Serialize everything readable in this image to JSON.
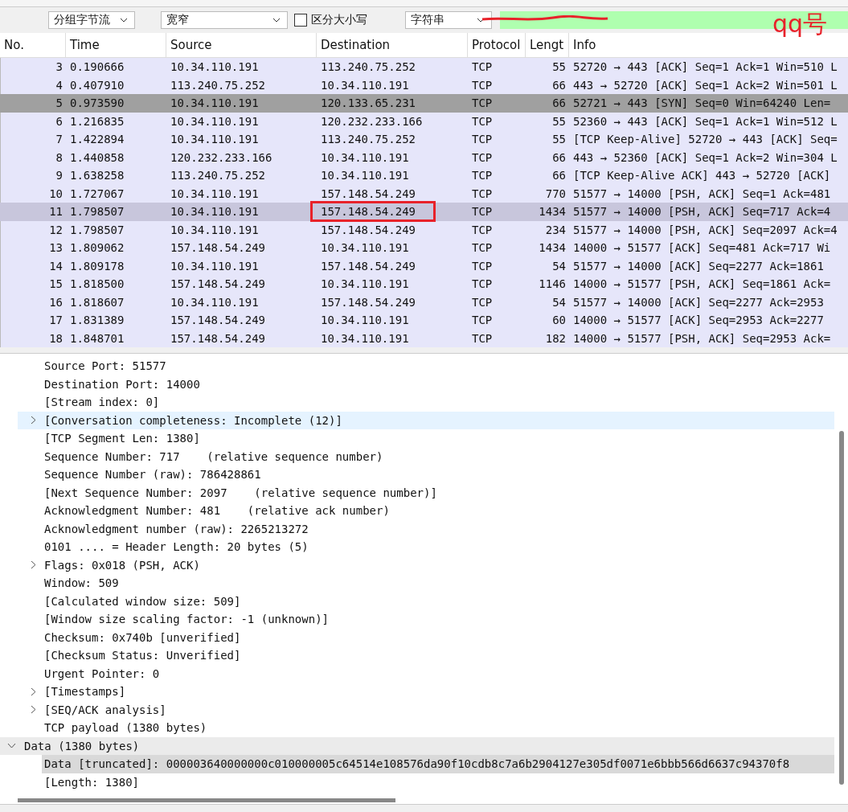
{
  "toolbar": {
    "display_mode": "分组字节流",
    "width_mode": "宽窄",
    "case_sensitive": {
      "label": "区分大小写",
      "checked": false
    },
    "search_type": "字符串",
    "search_field": {
      "redacted": true
    }
  },
  "annotation": {
    "label": "qq号"
  },
  "packet_list": {
    "columns": [
      "No.",
      "Time",
      "Source",
      "Destination",
      "Protocol",
      "Lengt",
      "Info"
    ],
    "rows": [
      {
        "no": "3",
        "time": "0.190666",
        "source": "10.34.110.191",
        "destination": "113.240.75.252",
        "protocol": "TCP",
        "length": "55",
        "info": "52720 → 443 [ACK] Seq=1 Ack=1 Win=510 L",
        "selected": false,
        "marked": false,
        "boxed": false
      },
      {
        "no": "4",
        "time": "0.407910",
        "source": "113.240.75.252",
        "destination": "10.34.110.191",
        "protocol": "TCP",
        "length": "66",
        "info": "443 → 52720 [ACK] Seq=1 Ack=2 Win=501 L",
        "selected": false,
        "marked": false,
        "boxed": false
      },
      {
        "no": "5",
        "time": "0.973590",
        "source": "10.34.110.191",
        "destination": "120.133.65.231",
        "protocol": "TCP",
        "length": "66",
        "info": "52721 → 443 [SYN] Seq=0 Win=64240 Len=",
        "selected": false,
        "marked": true,
        "boxed": false
      },
      {
        "no": "6",
        "time": "1.216835",
        "source": "10.34.110.191",
        "destination": "120.232.233.166",
        "protocol": "TCP",
        "length": "55",
        "info": "52360 → 443 [ACK] Seq=1 Ack=1 Win=512 L",
        "selected": false,
        "marked": false,
        "boxed": false
      },
      {
        "no": "7",
        "time": "1.422894",
        "source": "10.34.110.191",
        "destination": "113.240.75.252",
        "protocol": "TCP",
        "length": "55",
        "info": "[TCP Keep-Alive] 52720 → 443 [ACK] Seq=",
        "selected": false,
        "marked": false,
        "boxed": false
      },
      {
        "no": "8",
        "time": "1.440858",
        "source": "120.232.233.166",
        "destination": "10.34.110.191",
        "protocol": "TCP",
        "length": "66",
        "info": "443 → 52360 [ACK] Seq=1 Ack=2 Win=304 L",
        "selected": false,
        "marked": false,
        "boxed": false
      },
      {
        "no": "9",
        "time": "1.638258",
        "source": "113.240.75.252",
        "destination": "10.34.110.191",
        "protocol": "TCP",
        "length": "66",
        "info": "[TCP Keep-Alive ACK] 443 → 52720 [ACK]",
        "selected": false,
        "marked": false,
        "boxed": false
      },
      {
        "no": "10",
        "time": "1.727067",
        "source": "10.34.110.191",
        "destination": "157.148.54.249",
        "protocol": "TCP",
        "length": "770",
        "info": "51577 → 14000 [PSH, ACK] Seq=1 Ack=481",
        "selected": false,
        "marked": false,
        "boxed": false
      },
      {
        "no": "11",
        "time": "1.798507",
        "source": "10.34.110.191",
        "destination": "157.148.54.249",
        "protocol": "TCP",
        "length": "1434",
        "info": "51577 → 14000 [PSH, ACK] Seq=717 Ack=4",
        "selected": true,
        "marked": false,
        "boxed": true
      },
      {
        "no": "12",
        "time": "1.798507",
        "source": "10.34.110.191",
        "destination": "157.148.54.249",
        "protocol": "TCP",
        "length": "234",
        "info": "51577 → 14000 [PSH, ACK] Seq=2097 Ack=4",
        "selected": false,
        "marked": false,
        "boxed": false
      },
      {
        "no": "13",
        "time": "1.809062",
        "source": "157.148.54.249",
        "destination": "10.34.110.191",
        "protocol": "TCP",
        "length": "1434",
        "info": "14000 → 51577 [ACK] Seq=481 Ack=717 Wi",
        "selected": false,
        "marked": false,
        "boxed": false
      },
      {
        "no": "14",
        "time": "1.809178",
        "source": "10.34.110.191",
        "destination": "157.148.54.249",
        "protocol": "TCP",
        "length": "54",
        "info": "51577 → 14000 [ACK] Seq=2277 Ack=1861",
        "selected": false,
        "marked": false,
        "boxed": false
      },
      {
        "no": "15",
        "time": "1.818500",
        "source": "157.148.54.249",
        "destination": "10.34.110.191",
        "protocol": "TCP",
        "length": "1146",
        "info": "14000 → 51577 [PSH, ACK] Seq=1861 Ack=",
        "selected": false,
        "marked": false,
        "boxed": false
      },
      {
        "no": "16",
        "time": "1.818607",
        "source": "10.34.110.191",
        "destination": "157.148.54.249",
        "protocol": "TCP",
        "length": "54",
        "info": "51577 → 14000 [ACK] Seq=2277 Ack=2953",
        "selected": false,
        "marked": false,
        "boxed": false
      },
      {
        "no": "17",
        "time": "1.831389",
        "source": "157.148.54.249",
        "destination": "10.34.110.191",
        "protocol": "TCP",
        "length": "60",
        "info": "14000 → 51577 [ACK] Seq=2953 Ack=2277",
        "selected": false,
        "marked": false,
        "boxed": false
      },
      {
        "no": "18",
        "time": "1.848701",
        "source": "157.148.54.249",
        "destination": "10.34.110.191",
        "protocol": "TCP",
        "length": "182",
        "info": "14000 → 51577 [PSH, ACK] Seq=2953 Ack=",
        "selected": false,
        "marked": false,
        "boxed": false
      }
    ]
  },
  "packet_details": {
    "tcp_fields": [
      {
        "label": "Source Port: 51577",
        "expandable": false,
        "hovered": false
      },
      {
        "label": "Destination Port: 14000",
        "expandable": false,
        "hovered": false
      },
      {
        "label": "[Stream index: 0]",
        "expandable": false,
        "hovered": false
      },
      {
        "label": "[Conversation completeness: Incomplete (12)]",
        "expandable": true,
        "expanded": false,
        "hovered": true
      },
      {
        "label": "[TCP Segment Len: 1380]",
        "expandable": false,
        "hovered": false
      },
      {
        "label": "Sequence Number: 717    (relative sequence number)",
        "expandable": false,
        "hovered": false
      },
      {
        "label": "Sequence Number (raw): 786428861",
        "expandable": false,
        "hovered": false
      },
      {
        "label": "[Next Sequence Number: 2097    (relative sequence number)]",
        "expandable": false,
        "hovered": false
      },
      {
        "label": "Acknowledgment Number: 481    (relative ack number)",
        "expandable": false,
        "hovered": false
      },
      {
        "label": "Acknowledgment number (raw): 2265213272",
        "expandable": false,
        "hovered": false
      },
      {
        "label": "0101 .... = Header Length: 20 bytes (5)",
        "expandable": false,
        "hovered": false
      },
      {
        "label": "Flags: 0x018 (PSH, ACK)",
        "expandable": true,
        "expanded": false,
        "hovered": false
      },
      {
        "label": "Window: 509",
        "expandable": false,
        "hovered": false
      },
      {
        "label": "[Calculated window size: 509]",
        "expandable": false,
        "hovered": false
      },
      {
        "label": "[Window size scaling factor: -1 (unknown)]",
        "expandable": false,
        "hovered": false
      },
      {
        "label": "Checksum: 0x740b [unverified]",
        "expandable": false,
        "hovered": false
      },
      {
        "label": "[Checksum Status: Unverified]",
        "expandable": false,
        "hovered": false
      },
      {
        "label": "Urgent Pointer: 0",
        "expandable": false,
        "hovered": false
      },
      {
        "label": "[Timestamps]",
        "expandable": true,
        "expanded": false,
        "hovered": false
      },
      {
        "label": "[SEQ/ACK analysis]",
        "expandable": true,
        "expanded": false,
        "hovered": false
      },
      {
        "label": "TCP payload (1380 bytes)",
        "expandable": false,
        "hovered": false
      }
    ],
    "data": {
      "label": "Data (1380 bytes)",
      "expanded": true,
      "children": [
        {
          "label": "Data [truncated]: 000003640000000c010000005c64514e108576da90f10cdb8c7a6b2904127e305df0071e6bbb566d6637c94370f8",
          "selected": true
        },
        {
          "label": "[Length: 1380]",
          "selected": false
        }
      ]
    }
  }
}
